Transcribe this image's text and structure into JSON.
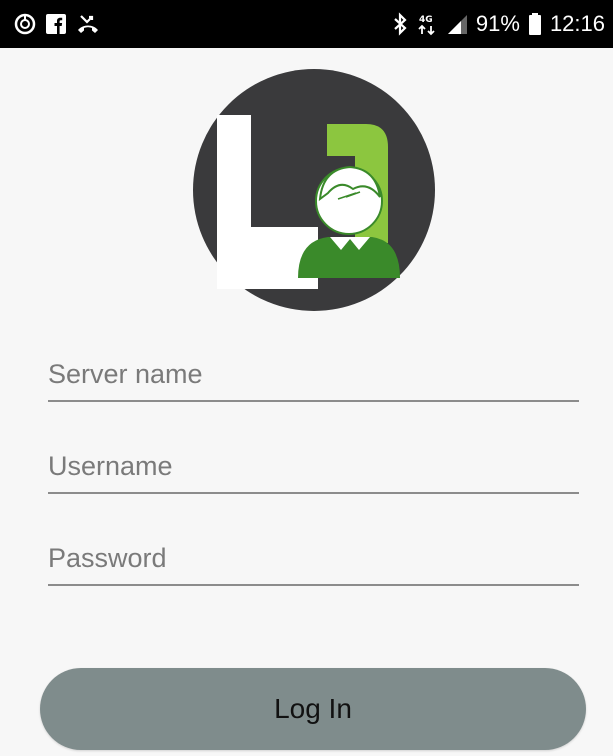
{
  "status_bar": {
    "icons_left": [
      "sync-icon",
      "facebook-icon",
      "missed-call-icon"
    ],
    "icons_right": [
      "bluetooth-icon",
      "network-4g-icon",
      "signal-icon",
      "battery-icon"
    ],
    "battery_percent": "91%",
    "time": "12:16"
  },
  "logo": {
    "icon": "app-logo-icon",
    "colors": {
      "circle": "#3a3a3c",
      "white": "#ffffff",
      "lime": "#8cc63f",
      "green": "#3a8a2a"
    }
  },
  "form": {
    "server_placeholder": "Server name",
    "server_value": "",
    "username_placeholder": "Username",
    "username_value": "",
    "password_placeholder": "Password",
    "password_value": ""
  },
  "login_button": {
    "label": "Log In",
    "color": "#7f8c8c"
  }
}
